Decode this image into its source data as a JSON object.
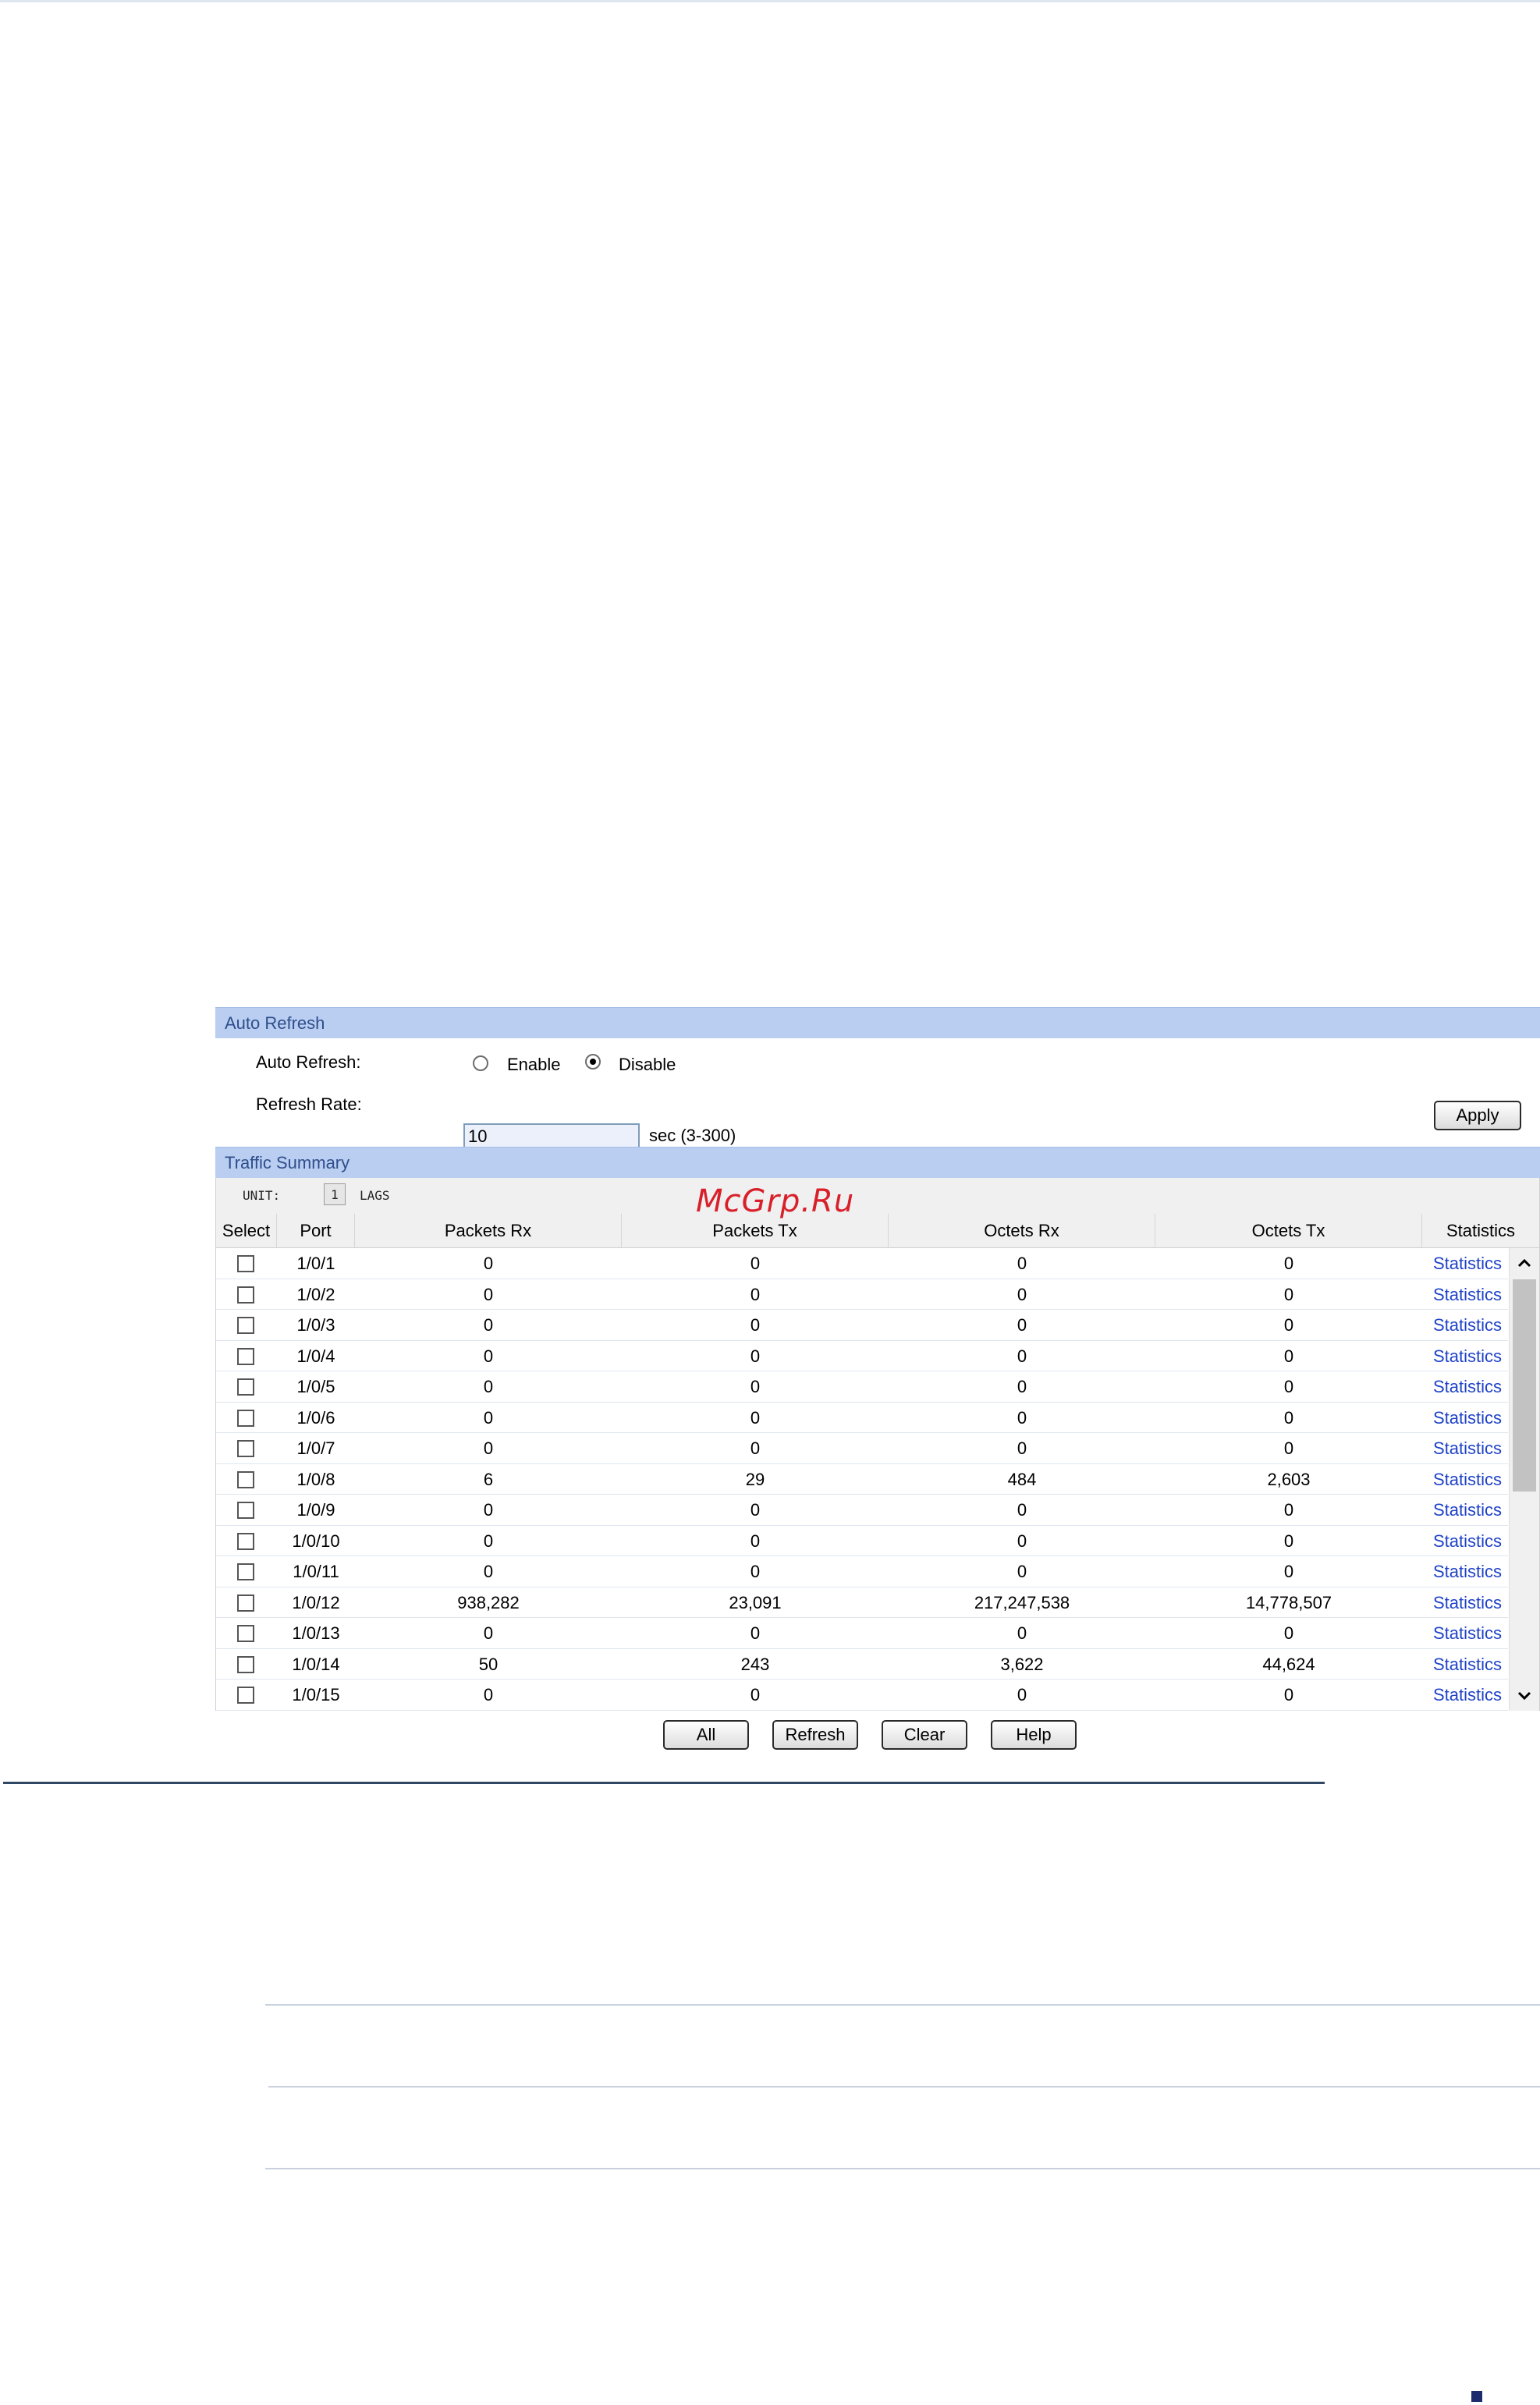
{
  "auto_refresh": {
    "section_title": "Auto Refresh",
    "label": "Auto Refresh:",
    "enable_label": "Enable",
    "disable_label": "Disable",
    "selected": "Disable",
    "rate_label": "Refresh Rate:",
    "rate_value": "10",
    "rate_hint": "sec (3-300)",
    "apply_label": "Apply"
  },
  "traffic_summary": {
    "section_title": "Traffic Summary",
    "unit_label": "UNIT:",
    "unit_value": "1",
    "lags_label": "LAGS",
    "columns": [
      "Select",
      "Port",
      "Packets Rx",
      "Packets Tx",
      "Octets Rx",
      "Octets Tx",
      "Statistics"
    ],
    "rows": [
      {
        "port": "1/0/1",
        "packets_rx": "0",
        "packets_tx": "0",
        "octets_rx": "0",
        "octets_tx": "0",
        "stats": "Statistics"
      },
      {
        "port": "1/0/2",
        "packets_rx": "0",
        "packets_tx": "0",
        "octets_rx": "0",
        "octets_tx": "0",
        "stats": "Statistics"
      },
      {
        "port": "1/0/3",
        "packets_rx": "0",
        "packets_tx": "0",
        "octets_rx": "0",
        "octets_tx": "0",
        "stats": "Statistics"
      },
      {
        "port": "1/0/4",
        "packets_rx": "0",
        "packets_tx": "0",
        "octets_rx": "0",
        "octets_tx": "0",
        "stats": "Statistics"
      },
      {
        "port": "1/0/5",
        "packets_rx": "0",
        "packets_tx": "0",
        "octets_rx": "0",
        "octets_tx": "0",
        "stats": "Statistics"
      },
      {
        "port": "1/0/6",
        "packets_rx": "0",
        "packets_tx": "0",
        "octets_rx": "0",
        "octets_tx": "0",
        "stats": "Statistics"
      },
      {
        "port": "1/0/7",
        "packets_rx": "0",
        "packets_tx": "0",
        "octets_rx": "0",
        "octets_tx": "0",
        "stats": "Statistics"
      },
      {
        "port": "1/0/8",
        "packets_rx": "6",
        "packets_tx": "29",
        "octets_rx": "484",
        "octets_tx": "2,603",
        "stats": "Statistics"
      },
      {
        "port": "1/0/9",
        "packets_rx": "0",
        "packets_tx": "0",
        "octets_rx": "0",
        "octets_tx": "0",
        "stats": "Statistics"
      },
      {
        "port": "1/0/10",
        "packets_rx": "0",
        "packets_tx": "0",
        "octets_rx": "0",
        "octets_tx": "0",
        "stats": "Statistics"
      },
      {
        "port": "1/0/11",
        "packets_rx": "0",
        "packets_tx": "0",
        "octets_rx": "0",
        "octets_tx": "0",
        "stats": "Statistics"
      },
      {
        "port": "1/0/12",
        "packets_rx": "938,282",
        "packets_tx": "23,091",
        "octets_rx": "217,247,538",
        "octets_tx": "14,778,507",
        "stats": "Statistics"
      },
      {
        "port": "1/0/13",
        "packets_rx": "0",
        "packets_tx": "0",
        "octets_rx": "0",
        "octets_tx": "0",
        "stats": "Statistics"
      },
      {
        "port": "1/0/14",
        "packets_rx": "50",
        "packets_tx": "243",
        "octets_rx": "3,622",
        "octets_tx": "44,624",
        "stats": "Statistics"
      },
      {
        "port": "1/0/15",
        "packets_rx": "0",
        "packets_tx": "0",
        "octets_rx": "0",
        "octets_tx": "0",
        "stats": "Statistics"
      }
    ],
    "buttons": {
      "all": "All",
      "refresh": "Refresh",
      "clear": "Clear",
      "help": "Help"
    }
  },
  "watermark": "McGrp.Ru",
  "colors": {
    "section_header_bg": "#b9cef0",
    "section_header_text": "#2f4e8c",
    "link": "#1f43c8"
  }
}
